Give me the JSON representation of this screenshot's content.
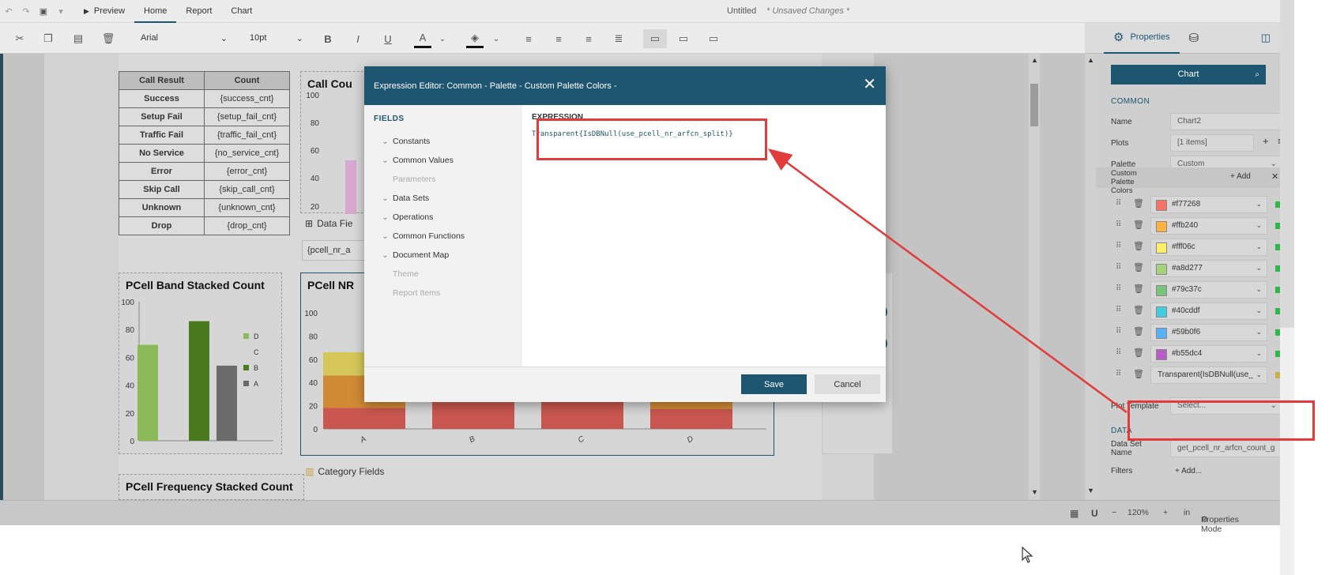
{
  "titlebar": {
    "menu": [
      "Preview",
      "Home",
      "Report",
      "Chart"
    ],
    "active_menu": "Home",
    "doc_title": "Untitled",
    "unsaved": "* Unsaved Changes *"
  },
  "toolbar": {
    "font_family": "Arial",
    "font_size": "10pt"
  },
  "table": {
    "headers": [
      "Call Result",
      "Count"
    ],
    "rows": [
      [
        "Success",
        "{success_cnt}"
      ],
      [
        "Setup Fail",
        "{setup_fail_cnt}"
      ],
      [
        "Traffic Fail",
        "{traffic_fail_cnt}"
      ],
      [
        "No Service",
        "{no_service_cnt}"
      ],
      [
        "Error",
        "{error_cnt}"
      ],
      [
        "Skip Call",
        "{skip_call_cnt}"
      ],
      [
        "Unknown",
        "{unknown_cnt}"
      ],
      [
        "Drop",
        "{drop_cnt}"
      ]
    ]
  },
  "canvas": {
    "call_count_title": "Call Cou",
    "data_fields_label": "Data Fie",
    "data_field_value": "{pcell_nr_a",
    "band_chart_title": "PCell Band Stacked Count",
    "nr_chart_title": "PCell NR",
    "freq_chart_title": "PCell Frequency Stacked Count",
    "category_fields_label": "Category Fields",
    "partial_split_text": "n_split",
    "badge_value": "1"
  },
  "chart_data": [
    {
      "type": "bar",
      "title": "PCell Band Stacked Count",
      "categories": [
        "D",
        "B",
        "A"
      ],
      "values": [
        69,
        86,
        54
      ],
      "ylim": [
        0,
        100
      ],
      "yticks": [
        0,
        20,
        40,
        60,
        80,
        100
      ],
      "legend": [
        "D",
        "C",
        "B",
        "A"
      ],
      "colors": [
        "#8cba5a",
        "#4a7a1e",
        "#6b6b6b"
      ]
    },
    {
      "type": "bar",
      "title": "PCell NR",
      "categories": [
        "A",
        "B",
        "C",
        "D"
      ],
      "ylim": [
        0,
        100
      ],
      "yticks": [
        0,
        20,
        40,
        60,
        80,
        100
      ],
      "series": [
        {
          "color": "#c9574f",
          "values": [
            18,
            23,
            31,
            17
          ]
        },
        {
          "color": "#d08a34",
          "values": [
            28,
            11,
            5,
            17
          ]
        },
        {
          "color": "#d6c75a",
          "values": [
            20,
            0,
            0,
            0
          ]
        }
      ]
    }
  ],
  "dialog": {
    "title": "Expression Editor: Common - Palette - Custom Palette Colors -",
    "fields_title": "FIELDS",
    "tree": [
      {
        "label": "Constants",
        "enabled": true
      },
      {
        "label": "Common Values",
        "enabled": true
      },
      {
        "label": "Parameters",
        "enabled": false
      },
      {
        "label": "Data Sets",
        "enabled": true
      },
      {
        "label": "Operations",
        "enabled": true
      },
      {
        "label": "Common Functions",
        "enabled": true
      },
      {
        "label": "Document Map",
        "enabled": true
      },
      {
        "label": "Theme",
        "enabled": false
      },
      {
        "label": "Report Items",
        "enabled": false
      }
    ],
    "expression_label": "EXPRESSION",
    "expression": "Transparent{IsDBNull(use_pcell_nr_arfcn_split)}",
    "save_label": "Save",
    "cancel_label": "Cancel"
  },
  "panel": {
    "tabs": [
      "Properties"
    ],
    "search": "Chart",
    "common_label": "COMMON",
    "name_label": "Name",
    "name_value": "Chart2",
    "plots_label": "Plots",
    "plots_value": "[1 items]",
    "palette_label": "Palette",
    "palette_value": "Custom",
    "custom_colors_label": "Custom Palette Colors",
    "add_label": "Add",
    "colors": [
      {
        "hex": "#f77268",
        "color": "#f77268"
      },
      {
        "hex": "#ffb240",
        "color": "#ffb240"
      },
      {
        "hex": "#fff06c",
        "color": "#fff06c"
      },
      {
        "hex": "#a8d277",
        "color": "#a8d277"
      },
      {
        "hex": "#79c37c",
        "color": "#79c37c"
      },
      {
        "hex": "#40cddf",
        "color": "#40cddf"
      },
      {
        "hex": "#59b0f6",
        "color": "#59b0f6"
      },
      {
        "hex": "#b55dc4",
        "color": "#b55dc4"
      }
    ],
    "custom_expr_value": "Transparent{IsDBNull(use_",
    "plot_template_label": "Plot Template",
    "plot_template_value": "Select...",
    "data_label": "DATA",
    "dataset_label": "Data Set Name",
    "dataset_value": "get_pcell_nr_arfcn_count_g",
    "filters_label": "Filters",
    "filters_add": "Add..."
  },
  "statusbar": {
    "zoom": "120%",
    "unit": "in",
    "mode": "Properties Mode"
  },
  "colors": {
    "accent": "#1e5570",
    "highlight": "#e23b3b"
  }
}
